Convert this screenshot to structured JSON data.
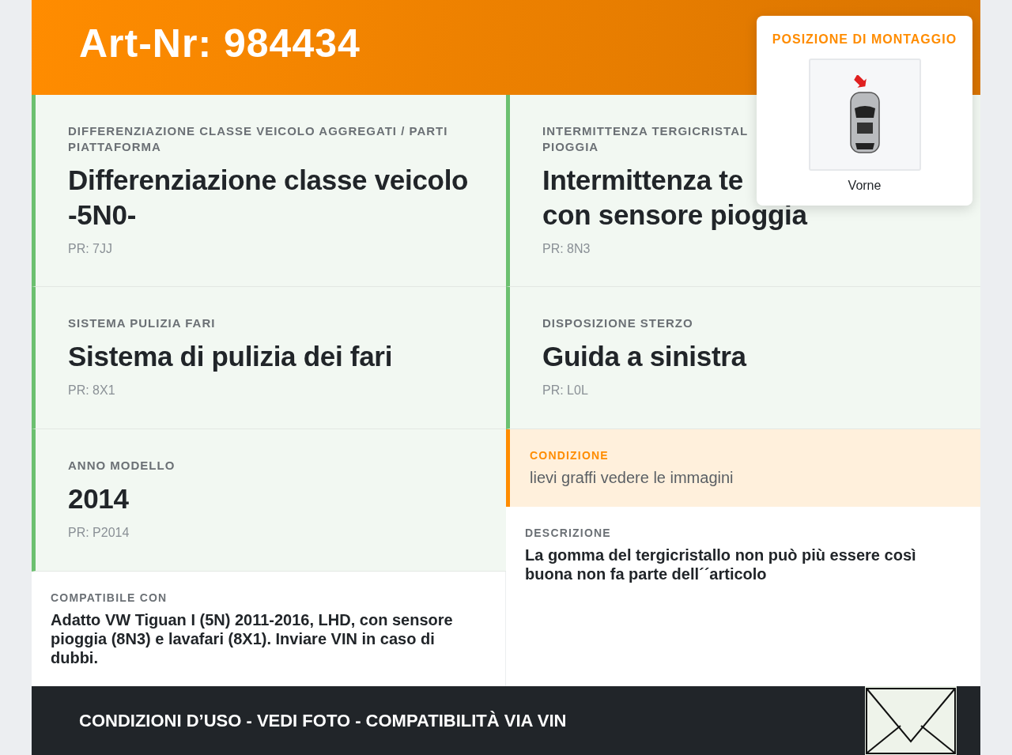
{
  "header": {
    "title": "Art-Nr: 984434"
  },
  "mounting_position": {
    "title": "POSIZIONE DI MONTAGGIO",
    "caption": "Vorne"
  },
  "specs": [
    {
      "label_lines": [
        "DIFFERENZIAZIONE CLASSE VEICOLO AGGREGATI / PARTI PIATTAFORMA"
      ],
      "title_lines": [
        "Differenziazione classe veicolo -5N0-"
      ],
      "pr": "PR: 7JJ"
    },
    {
      "label_lines": [
        "INTERMITTENZA TERGICRISTAL",
        "PIOGGIA"
      ],
      "title_lines": [
        "Intermittenza te",
        "con sensore pioggia"
      ],
      "pr": "PR: 8N3"
    },
    {
      "label_lines": [
        "SISTEMA PULIZIA FARI"
      ],
      "title_lines": [
        "Sistema di pulizia dei fari"
      ],
      "pr": "PR: 8X1"
    },
    {
      "label_lines": [
        "DISPOSIZIONE STERZO"
      ],
      "title_lines": [
        "Guida a sinistra"
      ],
      "pr": "PR: L0L"
    },
    {
      "label_lines": [
        "ANNO MODELLO"
      ],
      "title_lines": [
        "2014"
      ],
      "pr": "PR: P2014"
    }
  ],
  "condition": {
    "label": "CONDIZIONE",
    "text": "lievi graffi vedere le immagini"
  },
  "description": {
    "label": "DESCRIZIONE",
    "text": "La gomma del tergicristallo non può più essere così buona non fa parte dell´´articolo"
  },
  "compatible": {
    "label": "COMPATIBILE CON",
    "text": "Adatto VW Tiguan I (5N) 2011-2016, LHD, con sensore pioggia (8N3) e lavafari (8X1). Inviare VIN in caso di dubbi."
  },
  "footer": {
    "text": "CONDIZIONI D’USO - VEDI FOTO - COMPATIBILITÀ VIA VIN"
  }
}
